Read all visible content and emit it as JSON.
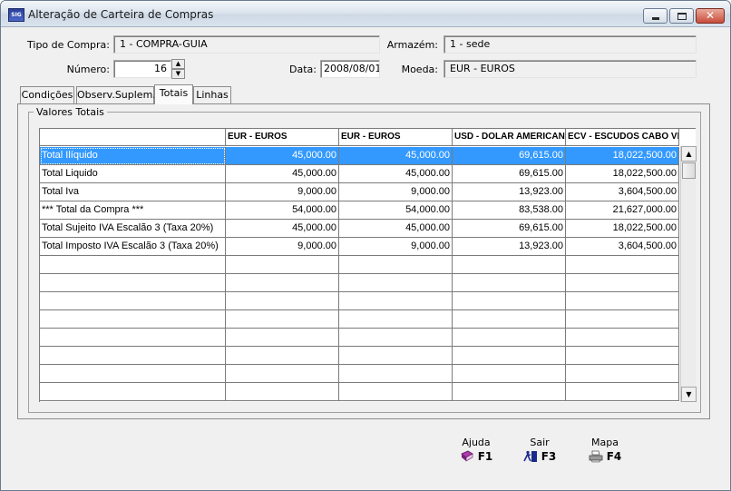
{
  "window": {
    "title": "Alteração de Carteira de Compras",
    "app_icon_text": "SIG"
  },
  "form": {
    "tipo_compra_label": "Tipo de Compra:",
    "tipo_compra_value": "1 - COMPRA-GUIA",
    "armazem_label": "Armazém:",
    "armazem_value": "1 - sede",
    "numero_label": "Número:",
    "numero_value": "16",
    "data_label": "Data:",
    "data_value": "2008/08/01",
    "moeda_label": "Moeda:",
    "moeda_value": "EUR - EUROS"
  },
  "tabs": [
    {
      "label": "Condições"
    },
    {
      "label": "Observ.Suplem."
    },
    {
      "label": "Totais",
      "active": true
    },
    {
      "label": "Linhas"
    }
  ],
  "group": {
    "title": "Valores Totais"
  },
  "grid": {
    "columns": [
      "EUR - EUROS",
      "EUR - EUROS",
      "USD - DOLAR AMERICANO",
      "ECV - ESCUDOS CABO VERDE"
    ],
    "rows": [
      {
        "label": "Total Ilíquido",
        "values": [
          "45,000.00",
          "45,000.00",
          "69,615.00",
          "18,022,500.00"
        ],
        "selected": true
      },
      {
        "label": "Total Liquido",
        "values": [
          "45,000.00",
          "45,000.00",
          "69,615.00",
          "18,022,500.00"
        ]
      },
      {
        "label": "Total Iva",
        "values": [
          "9,000.00",
          "9,000.00",
          "13,923.00",
          "3,604,500.00"
        ]
      },
      {
        "label": "*** Total da Compra ***",
        "values": [
          "54,000.00",
          "54,000.00",
          "83,538.00",
          "21,627,000.00"
        ]
      },
      {
        "label": "Total Sujeito IVA Escalão 3 (Taxa 20%)",
        "values": [
          "45,000.00",
          "45,000.00",
          "69,615.00",
          "18,022,500.00"
        ]
      },
      {
        "label": "Total Imposto IVA Escalão 3 (Taxa 20%)",
        "values": [
          "9,000.00",
          "9,000.00",
          "13,923.00",
          "3,604,500.00"
        ]
      },
      {
        "label": "",
        "values": [
          "",
          "",
          "",
          ""
        ]
      },
      {
        "label": "",
        "values": [
          "",
          "",
          "",
          ""
        ]
      },
      {
        "label": "",
        "values": [
          "",
          "",
          "",
          ""
        ]
      },
      {
        "label": "",
        "values": [
          "",
          "",
          "",
          ""
        ]
      },
      {
        "label": "",
        "values": [
          "",
          "",
          "",
          ""
        ]
      },
      {
        "label": "",
        "values": [
          "",
          "",
          "",
          ""
        ]
      },
      {
        "label": "",
        "values": [
          "",
          "",
          "",
          ""
        ]
      },
      {
        "label": "",
        "values": [
          "",
          "",
          "",
          ""
        ]
      }
    ]
  },
  "function_keys": [
    {
      "label": "Ajuda",
      "key": "F1",
      "icon": "book-icon"
    },
    {
      "label": "Sair",
      "key": "F3",
      "icon": "exit-door-icon"
    },
    {
      "label": "Mapa",
      "key": "F4",
      "icon": "printer-icon"
    }
  ],
  "colors": {
    "selection": "#3399ff",
    "window_bg": "#f0f0f0"
  }
}
